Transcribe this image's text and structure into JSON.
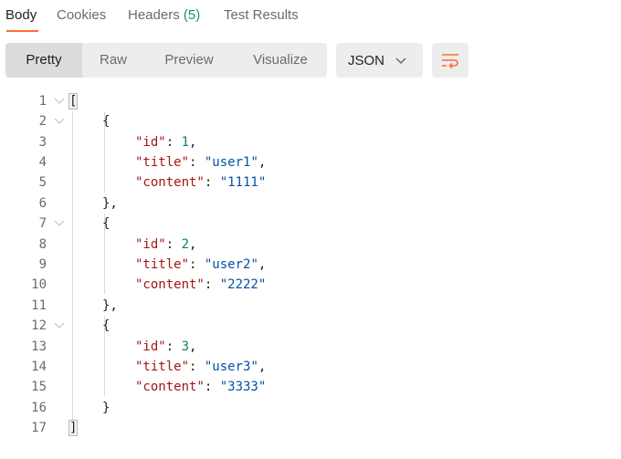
{
  "tabs": [
    {
      "label": "Body"
    },
    {
      "label": "Cookies"
    },
    {
      "label": "Headers",
      "count": "(5)"
    },
    {
      "label": "Test Results"
    }
  ],
  "view_modes": [
    "Pretty",
    "Raw",
    "Preview",
    "Visualize"
  ],
  "format": {
    "selected": "JSON",
    "icon": "chevron-down-icon"
  },
  "wrap_icon": "wrap-lines-icon",
  "colors": {
    "accent": "#ff6c37",
    "count": "#0f9d58",
    "key": "#a31515",
    "string": "#0451a5",
    "number": "#098658"
  },
  "code": {
    "line_numbers": [
      "1",
      "2",
      "3",
      "4",
      "5",
      "6",
      "7",
      "8",
      "9",
      "10",
      "11",
      "12",
      "13",
      "14",
      "15",
      "16",
      "17"
    ],
    "open_bracket": "[",
    "close_bracket": "]",
    "open_brace": "{",
    "close_brace_comma": "},",
    "close_brace": "}",
    "records": [
      {
        "id": "1",
        "title": "\"user1\"",
        "content": "\"1111\""
      },
      {
        "id": "2",
        "title": "\"user2\"",
        "content": "\"2222\""
      },
      {
        "id": "3",
        "title": "\"user3\"",
        "content": "\"3333\""
      }
    ],
    "keys": {
      "id": "\"id\"",
      "title": "\"title\"",
      "content": "\"content\""
    },
    "colon": ": ",
    "comma": ","
  }
}
